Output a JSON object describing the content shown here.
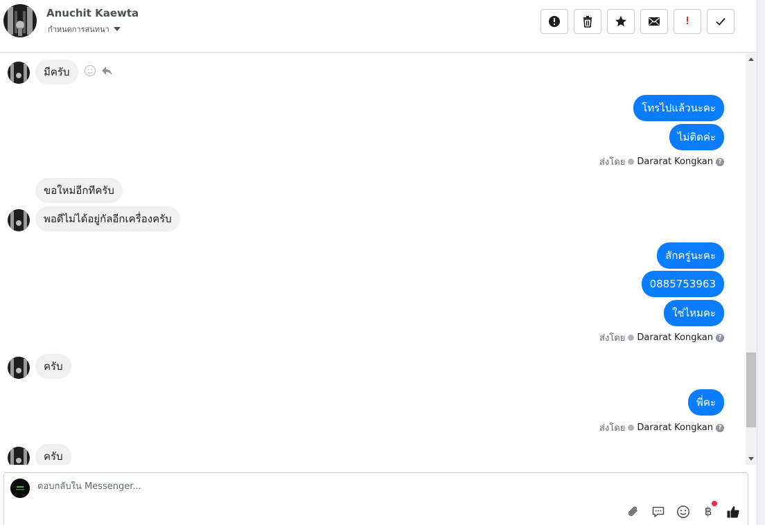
{
  "header": {
    "contact_name": "Anuchit Kaewta",
    "assign_label": "กำหนดการสนทนา",
    "actions": [
      {
        "name": "mark-spam-button",
        "icon": "alert-circle-icon"
      },
      {
        "name": "delete-button",
        "icon": "trash-icon"
      },
      {
        "name": "star-button",
        "icon": "star-icon"
      },
      {
        "name": "mark-unread-button",
        "icon": "envelope-icon"
      },
      {
        "name": "follow-up-button",
        "icon": "exclamation-icon",
        "symbol": "!"
      },
      {
        "name": "mark-done-button",
        "icon": "checkmark-icon"
      }
    ]
  },
  "messages": {
    "m1": "มีครับ",
    "m2": "โทรไปแล้วนะคะ",
    "m3": "ไม่ติดค่ะ",
    "sent1": {
      "prefix": "ส่งโดย",
      "name": "Dararat Kongkan",
      "help": "?"
    },
    "m4": "ขอใหม่อีกทีครับ",
    "m5": "พอดีไม่ได้อยู่กัลอีกเครื่องครับ",
    "m6": "สักครู่นะคะ",
    "m7": "0885753963",
    "m8": "ใช่ไหมคะ",
    "sent2": {
      "prefix": "ส่งโดย",
      "name": "Dararat Kongkan",
      "help": "?"
    },
    "m9": "ครับ",
    "m10": "พี่คะ",
    "sent3": {
      "prefix": "ส่งโดย",
      "name": "Dararat Kongkan",
      "help": "?"
    },
    "m11": "ครับ"
  },
  "composer": {
    "placeholder": "ตอบกลับใน Messenger...",
    "currency_symbol": "฿"
  },
  "colors": {
    "outgoing_bubble": "#0a7cff",
    "incoming_bubble": "#f0f0f0",
    "notification_dot": "#f02849"
  }
}
